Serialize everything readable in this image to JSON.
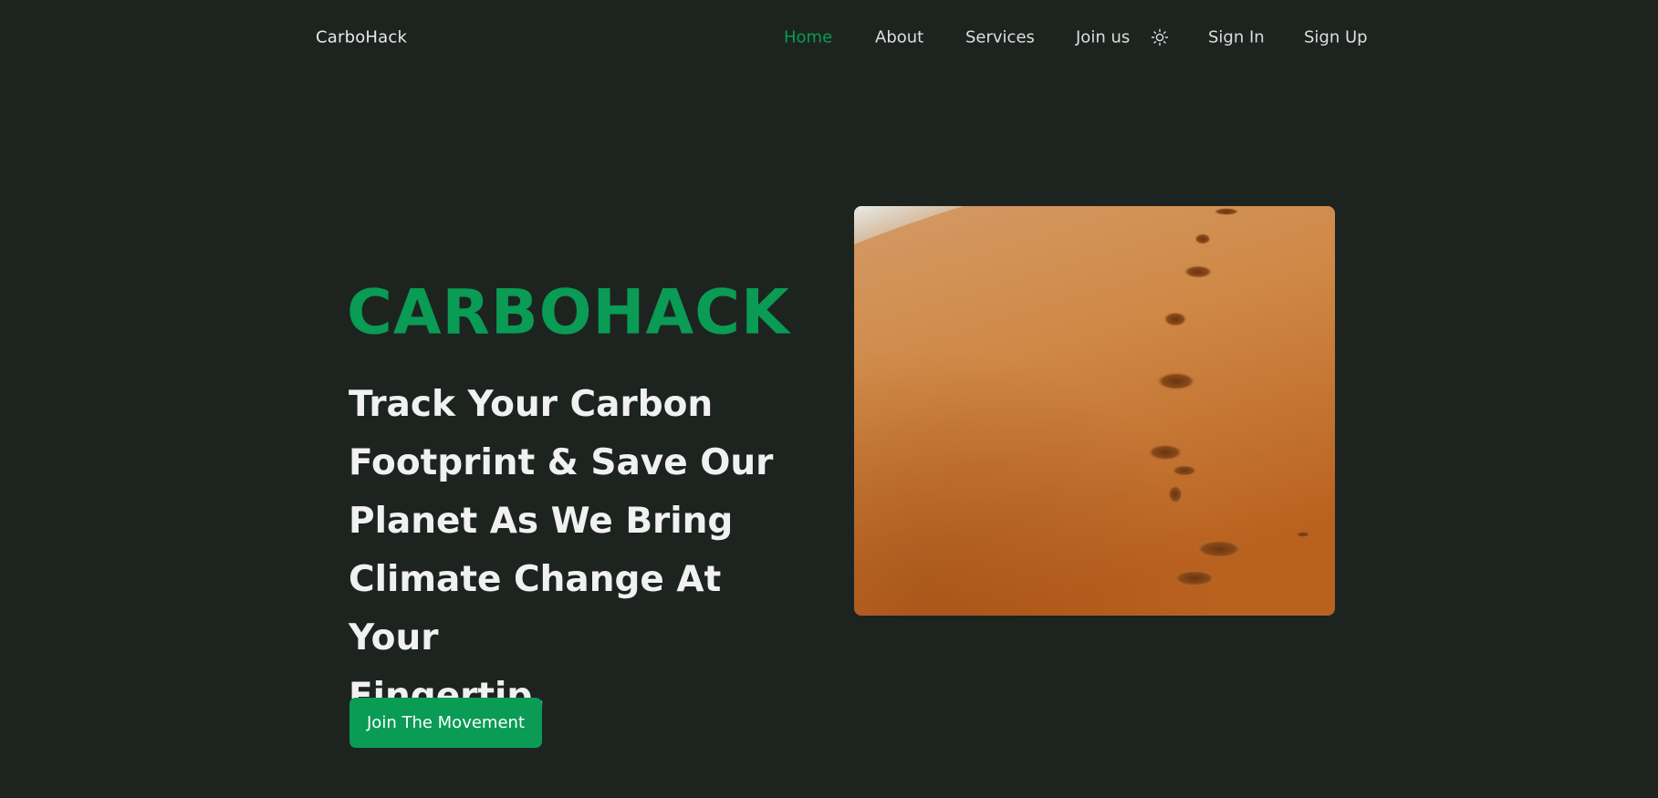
{
  "navbar": {
    "brand": "CarboHack",
    "links": [
      {
        "label": "Home",
        "active": true
      },
      {
        "label": "About",
        "active": false
      },
      {
        "label": "Services",
        "active": false
      },
      {
        "label": "Join us",
        "active": false
      }
    ],
    "theme_toggle_icon": "sun-icon",
    "sign_in": "Sign In",
    "sign_up": "Sign Up"
  },
  "hero": {
    "title": "CARBOHACK",
    "subtitle_lines": [
      "Track Your Carbon",
      "Footprint & Save Our",
      "Planet As We Bring",
      "Climate Change At Your",
      "Fingertip."
    ],
    "cta_label": "Join The Movement",
    "image": "footprints-in-sand-image"
  },
  "colors": {
    "background": "#1d2420",
    "accent": "#0a9b55",
    "text": "#f1f1f1",
    "nav_text": "#dedede"
  }
}
